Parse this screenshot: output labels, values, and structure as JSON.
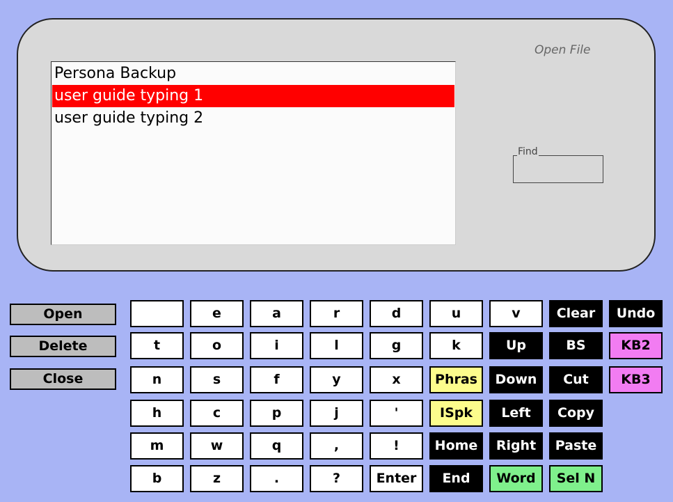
{
  "dialog": {
    "title": "Open File",
    "find_label": "Find",
    "files": [
      "Persona Backup",
      "user guide typing 1",
      "user guide typing 2"
    ],
    "selected_index": 1
  },
  "actions": [
    "Open",
    "Delete",
    "Close"
  ],
  "keyboard": {
    "rows": [
      [
        {
          "label": "",
          "style": "white"
        },
        {
          "label": "e",
          "style": "white"
        },
        {
          "label": "a",
          "style": "white"
        },
        {
          "label": "r",
          "style": "white"
        },
        {
          "label": "d",
          "style": "white"
        },
        {
          "label": "u",
          "style": "white"
        },
        {
          "label": "v",
          "style": "white"
        },
        {
          "label": "Clear",
          "style": "dark"
        },
        {
          "label": "Undo",
          "style": "dark"
        }
      ],
      [
        {
          "label": "t",
          "style": "white"
        },
        {
          "label": "o",
          "style": "white"
        },
        {
          "label": "i",
          "style": "white"
        },
        {
          "label": "l",
          "style": "white"
        },
        {
          "label": "g",
          "style": "white"
        },
        {
          "label": "k",
          "style": "white"
        },
        {
          "label": "Up",
          "style": "dark"
        },
        {
          "label": "BS",
          "style": "dark"
        },
        {
          "label": "KB2",
          "style": "pink"
        }
      ],
      [
        {
          "label": "n",
          "style": "white"
        },
        {
          "label": "s",
          "style": "white"
        },
        {
          "label": "f",
          "style": "white"
        },
        {
          "label": "y",
          "style": "white"
        },
        {
          "label": "x",
          "style": "white"
        },
        {
          "label": "Phras",
          "style": "yellow"
        },
        {
          "label": "Down",
          "style": "dark"
        },
        {
          "label": "Cut",
          "style": "dark"
        },
        {
          "label": "KB3",
          "style": "pink"
        }
      ],
      [
        {
          "label": "h",
          "style": "white"
        },
        {
          "label": "c",
          "style": "white"
        },
        {
          "label": "p",
          "style": "white"
        },
        {
          "label": "j",
          "style": "white"
        },
        {
          "label": "'",
          "style": "white"
        },
        {
          "label": "ISpk",
          "style": "yellow"
        },
        {
          "label": "Left",
          "style": "dark"
        },
        {
          "label": "Copy",
          "style": "dark"
        }
      ],
      [
        {
          "label": "m",
          "style": "white"
        },
        {
          "label": "w",
          "style": "white"
        },
        {
          "label": "q",
          "style": "white"
        },
        {
          "label": ",",
          "style": "white"
        },
        {
          "label": "!",
          "style": "white"
        },
        {
          "label": "Home",
          "style": "dark"
        },
        {
          "label": "Right",
          "style": "dark"
        },
        {
          "label": "Paste",
          "style": "dark"
        }
      ],
      [
        {
          "label": "b",
          "style": "white"
        },
        {
          "label": "z",
          "style": "white"
        },
        {
          "label": ".",
          "style": "white"
        },
        {
          "label": "?",
          "style": "white"
        },
        {
          "label": "Enter",
          "style": "white"
        },
        {
          "label": "End",
          "style": "dark"
        },
        {
          "label": "Word",
          "style": "green"
        },
        {
          "label": "Sel N",
          "style": "green"
        }
      ]
    ],
    "colors": {
      "white": "#ffffff",
      "dark": "#000000",
      "yellow": "#fcfc8c",
      "green": "#7ff08c",
      "pink": "#f27cf2",
      "selection": "#ff0000",
      "background": "#a8b4f5"
    }
  }
}
